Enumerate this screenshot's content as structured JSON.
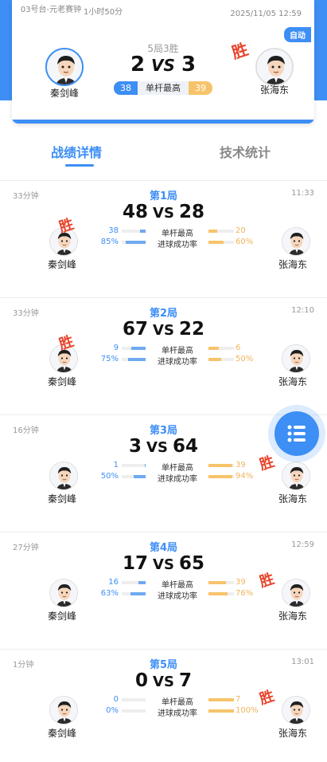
{
  "header": {
    "venue": "03号台-元老赛钟",
    "duration": "1小时50分",
    "datetime": "2025/11/05 12:59",
    "mode_badge": "自动",
    "format": "5局3胜",
    "score_left": "2",
    "score_right": "3",
    "vs": "VS",
    "max_break_label": "单杆最高",
    "max_break_left": "38",
    "max_break_right": "39",
    "winner_stamp": "胜",
    "player_left": "秦剑峰",
    "player_right": "张海东"
  },
  "tabs": {
    "details": "战绩详情",
    "stats": "技术统计"
  },
  "colors": {
    "primary": "#3d8ef5",
    "accent_orange": "#f7c36a",
    "win_red": "#e8452c"
  },
  "labels": {
    "max_break": "单杆最高",
    "pot_rate": "进球成功率",
    "vs": "VS",
    "win": "胜"
  },
  "rounds": [
    {
      "title": "第1局",
      "duration": "33分钟",
      "time": "11:33",
      "score_left": "48",
      "score_right": "28",
      "max_left": "38",
      "max_right": "20",
      "rate_left": "85%",
      "rate_right": "60%",
      "max_left_frac": 0.25,
      "max_right_frac": 0.35,
      "rate_left_frac": 0.85,
      "rate_right_frac": 0.6,
      "winner": "left",
      "player_left": "秦剑峰",
      "player_right": "张海东"
    },
    {
      "title": "第2局",
      "duration": "33分钟",
      "time": "12:10",
      "score_left": "67",
      "score_right": "22",
      "max_left": "9",
      "max_right": "6",
      "rate_left": "75%",
      "rate_right": "50%",
      "max_left_frac": 0.6,
      "max_right_frac": 0.4,
      "rate_left_frac": 0.75,
      "rate_right_frac": 0.5,
      "winner": "left",
      "player_left": "秦剑峰",
      "player_right": "张海东"
    },
    {
      "title": "第3局",
      "duration": "16分钟",
      "time": "",
      "score_left": "3",
      "score_right": "64",
      "max_left": "1",
      "max_right": "39",
      "rate_left": "50%",
      "rate_right": "94%",
      "max_left_frac": 0.05,
      "max_right_frac": 0.95,
      "rate_left_frac": 0.5,
      "rate_right_frac": 0.94,
      "winner": "right",
      "player_left": "秦剑峰",
      "player_right": "张海东"
    },
    {
      "title": "第4局",
      "duration": "27分钟",
      "time": "12:59",
      "score_left": "17",
      "score_right": "65",
      "max_left": "16",
      "max_right": "39",
      "rate_left": "63%",
      "rate_right": "76%",
      "max_left_frac": 0.3,
      "max_right_frac": 0.7,
      "rate_left_frac": 0.63,
      "rate_right_frac": 0.76,
      "winner": "right",
      "player_left": "秦剑峰",
      "player_right": "张海东"
    },
    {
      "title": "第5局",
      "duration": "1分钟",
      "time": "13:01",
      "score_left": "0",
      "score_right": "7",
      "max_left": "0",
      "max_right": "7",
      "rate_left": "0%",
      "rate_right": "100%",
      "max_left_frac": 0.0,
      "max_right_frac": 1.0,
      "rate_left_frac": 0.0,
      "rate_right_frac": 1.0,
      "winner": "right",
      "player_left": "秦剑峰",
      "player_right": "张海东"
    }
  ],
  "fab_icon": "list-menu-icon"
}
